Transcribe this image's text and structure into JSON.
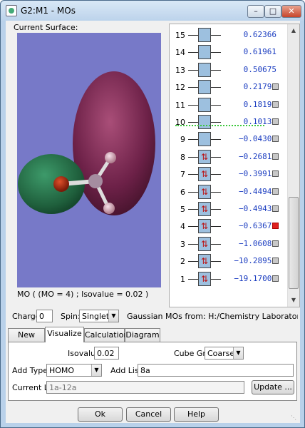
{
  "window": {
    "title": "G2:M1 - MOs"
  },
  "surface": {
    "label": "Current Surface:",
    "caption": "MO ( (MO = 4) ; Isovalue = 0.02 )"
  },
  "orbitals": [
    {
      "num": "15",
      "energy": "0.62366",
      "occupied": false,
      "checkbox": false,
      "selected": false
    },
    {
      "num": "14",
      "energy": "0.61961",
      "occupied": false,
      "checkbox": false,
      "selected": false
    },
    {
      "num": "13",
      "energy": "0.50675",
      "occupied": false,
      "checkbox": false,
      "selected": false
    },
    {
      "num": "12",
      "energy": "0.21797",
      "occupied": false,
      "checkbox": true,
      "selected": false
    },
    {
      "num": "11",
      "energy": "0.18193",
      "occupied": false,
      "checkbox": true,
      "selected": false
    },
    {
      "num": "10",
      "energy": "0.10133",
      "occupied": false,
      "checkbox": true,
      "selected": false
    },
    {
      "num": "9",
      "energy": "−0.04309",
      "occupied": false,
      "checkbox": true,
      "selected": false
    },
    {
      "num": "8",
      "energy": "−0.26816",
      "occupied": true,
      "checkbox": true,
      "selected": false
    },
    {
      "num": "7",
      "energy": "−0.39919",
      "occupied": true,
      "checkbox": true,
      "selected": false
    },
    {
      "num": "6",
      "energy": "−0.44941",
      "occupied": true,
      "checkbox": true,
      "selected": false
    },
    {
      "num": "5",
      "energy": "−0.49430",
      "occupied": true,
      "checkbox": true,
      "selected": false
    },
    {
      "num": "4",
      "energy": "−0.63678",
      "occupied": true,
      "checkbox": true,
      "selected": true
    },
    {
      "num": "3",
      "energy": "−1.06085",
      "occupied": true,
      "checkbox": true,
      "selected": false
    },
    {
      "num": "2",
      "energy": "−10.28952",
      "occupied": true,
      "checkbox": true,
      "selected": false
    },
    {
      "num": "1",
      "energy": "−19.17003",
      "occupied": true,
      "checkbox": true,
      "selected": false
    }
  ],
  "settings": {
    "charge_label": "Charge:",
    "charge_value": "0",
    "spin_label": "Spin:",
    "spin_value": "Singlet",
    "source_text": "Gaussian MOs from:  H:/Chemistry Laboratories/Compu"
  },
  "tabs": [
    "New MOs",
    "Visualize",
    "Calculation",
    "Diagram"
  ],
  "visualize": {
    "isovalue_label": "Isovalue:",
    "isovalue_value": "0.02",
    "cube_grid_label": "Cube Grid:",
    "cube_grid_value": "Coarse",
    "add_type_label": "Add Type:",
    "add_type_value": "HOMO",
    "add_list_label": "Add List:",
    "add_list_value": "8a",
    "current_list_label": "Current List:",
    "current_list_value": "1a-12a",
    "update_label": "Update ..."
  },
  "buttons": {
    "ok": "Ok",
    "cancel": "Cancel",
    "help": "Help"
  },
  "colors": {
    "viewport_bg": "#7779c8",
    "lobe_red": "#7a2e55",
    "lobe_green": "#2e7a52",
    "energy_text": "#1a3cc0",
    "homo_line": "#3cc83c",
    "selected": "#e02020"
  },
  "icons": {
    "app": "gaussview-icon",
    "minimize": "minimize-icon",
    "maximize": "maximize-icon",
    "close": "close-icon"
  }
}
